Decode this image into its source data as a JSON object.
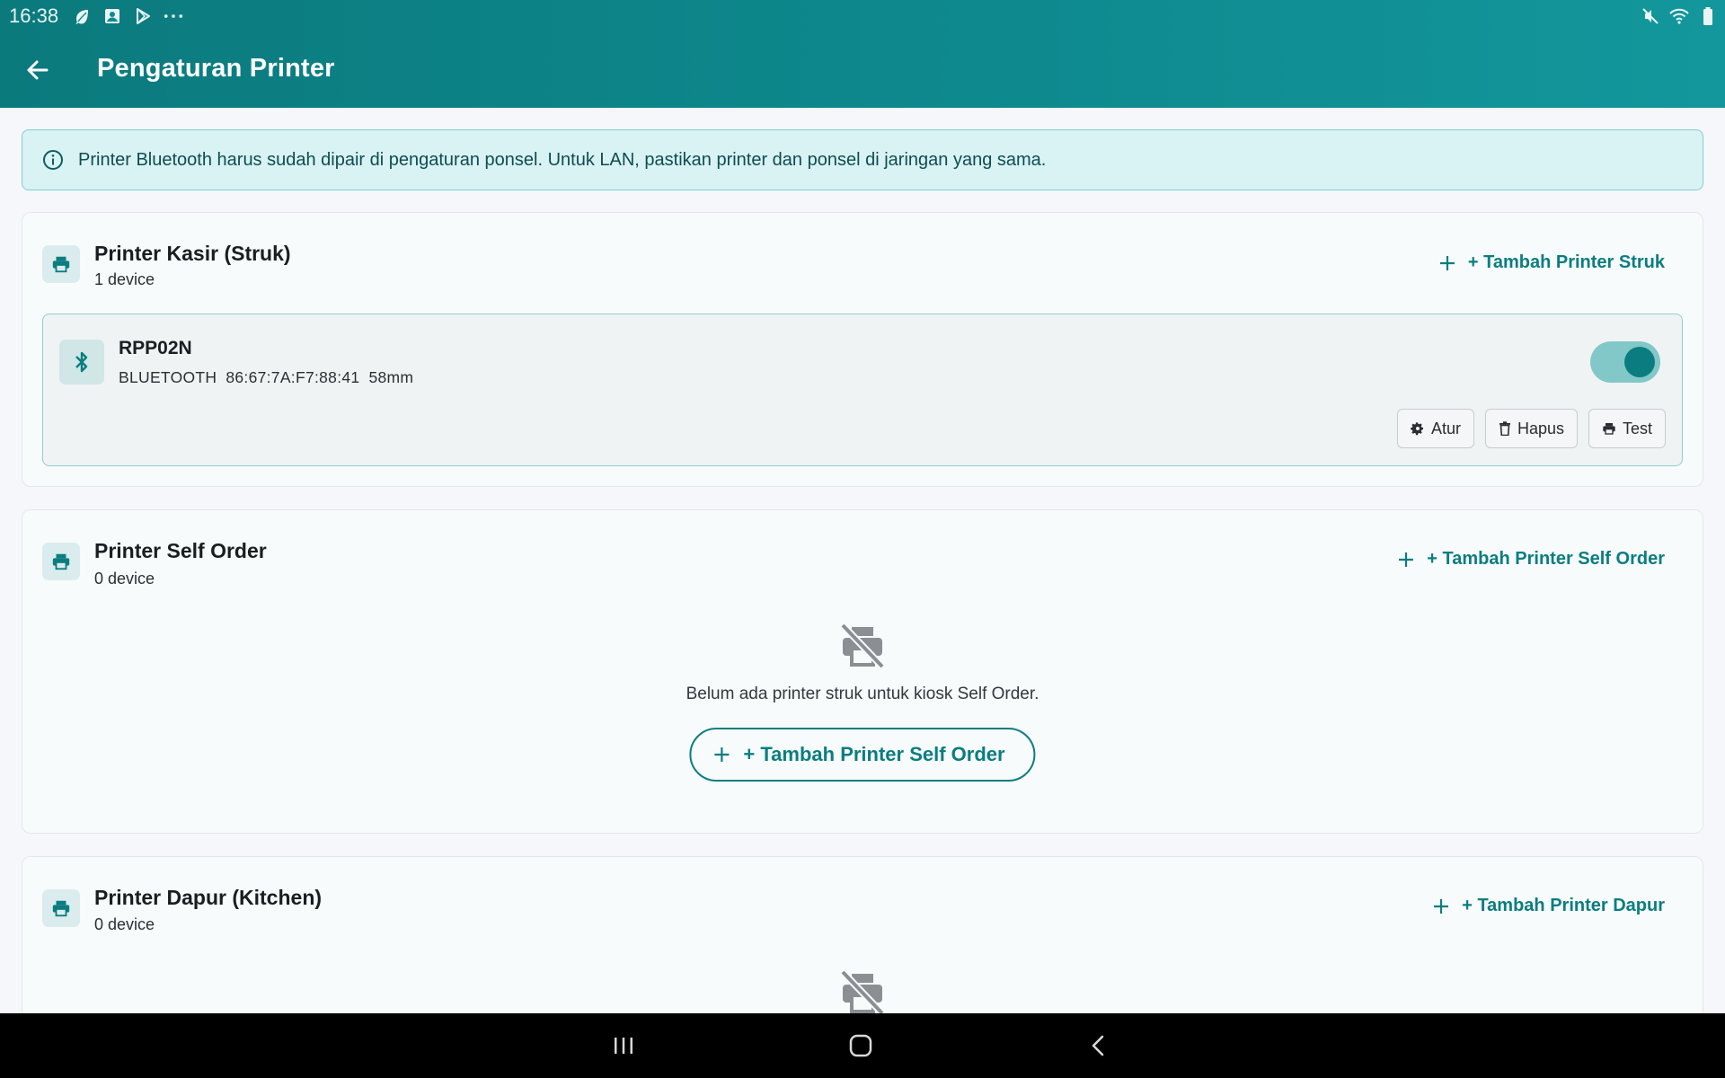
{
  "status_bar": {
    "time": "16:38",
    "left_icons": [
      "leaf-icon",
      "image-icon",
      "play-store-icon",
      "more-dots-icon"
    ],
    "right_icons": [
      "mute-icon",
      "wifi-icon",
      "battery-icon"
    ]
  },
  "app_bar": {
    "title": "Pengaturan Printer",
    "back_icon": "arrow-left-icon"
  },
  "info_banner": {
    "icon": "info-icon",
    "text": "Printer Bluetooth harus sudah dipair di pengaturan ponsel. Untuk LAN, pastikan printer dan ponsel di jaringan yang sama."
  },
  "sections": [
    {
      "title": "Printer Kasir (Struk)",
      "count": "1 device",
      "add_label": "+ Tambah Printer Struk",
      "devices": [
        {
          "name": "RPP02N",
          "type": "BLUETOOTH",
          "address": "86:67:7A:F7:88:41",
          "paper": "58mm",
          "enabled": true,
          "actions": [
            "Atur",
            "Hapus",
            "Test"
          ]
        }
      ]
    },
    {
      "title": "Printer Self Order",
      "count": "0 device",
      "add_label": "+ Tambah Printer Self Order",
      "empty_text": "Belum ada printer struk untuk kiosk Self Order.",
      "empty_button": "+ Tambah Printer Self Order"
    },
    {
      "title": "Printer Dapur (Kitchen)",
      "count": "0 device",
      "add_label": "+ Tambah Printer Dapur"
    }
  ],
  "colors": {
    "primary": "#0b7d80",
    "appbar": "#0e8a8f",
    "banner_bg": "#d9f2f3"
  }
}
